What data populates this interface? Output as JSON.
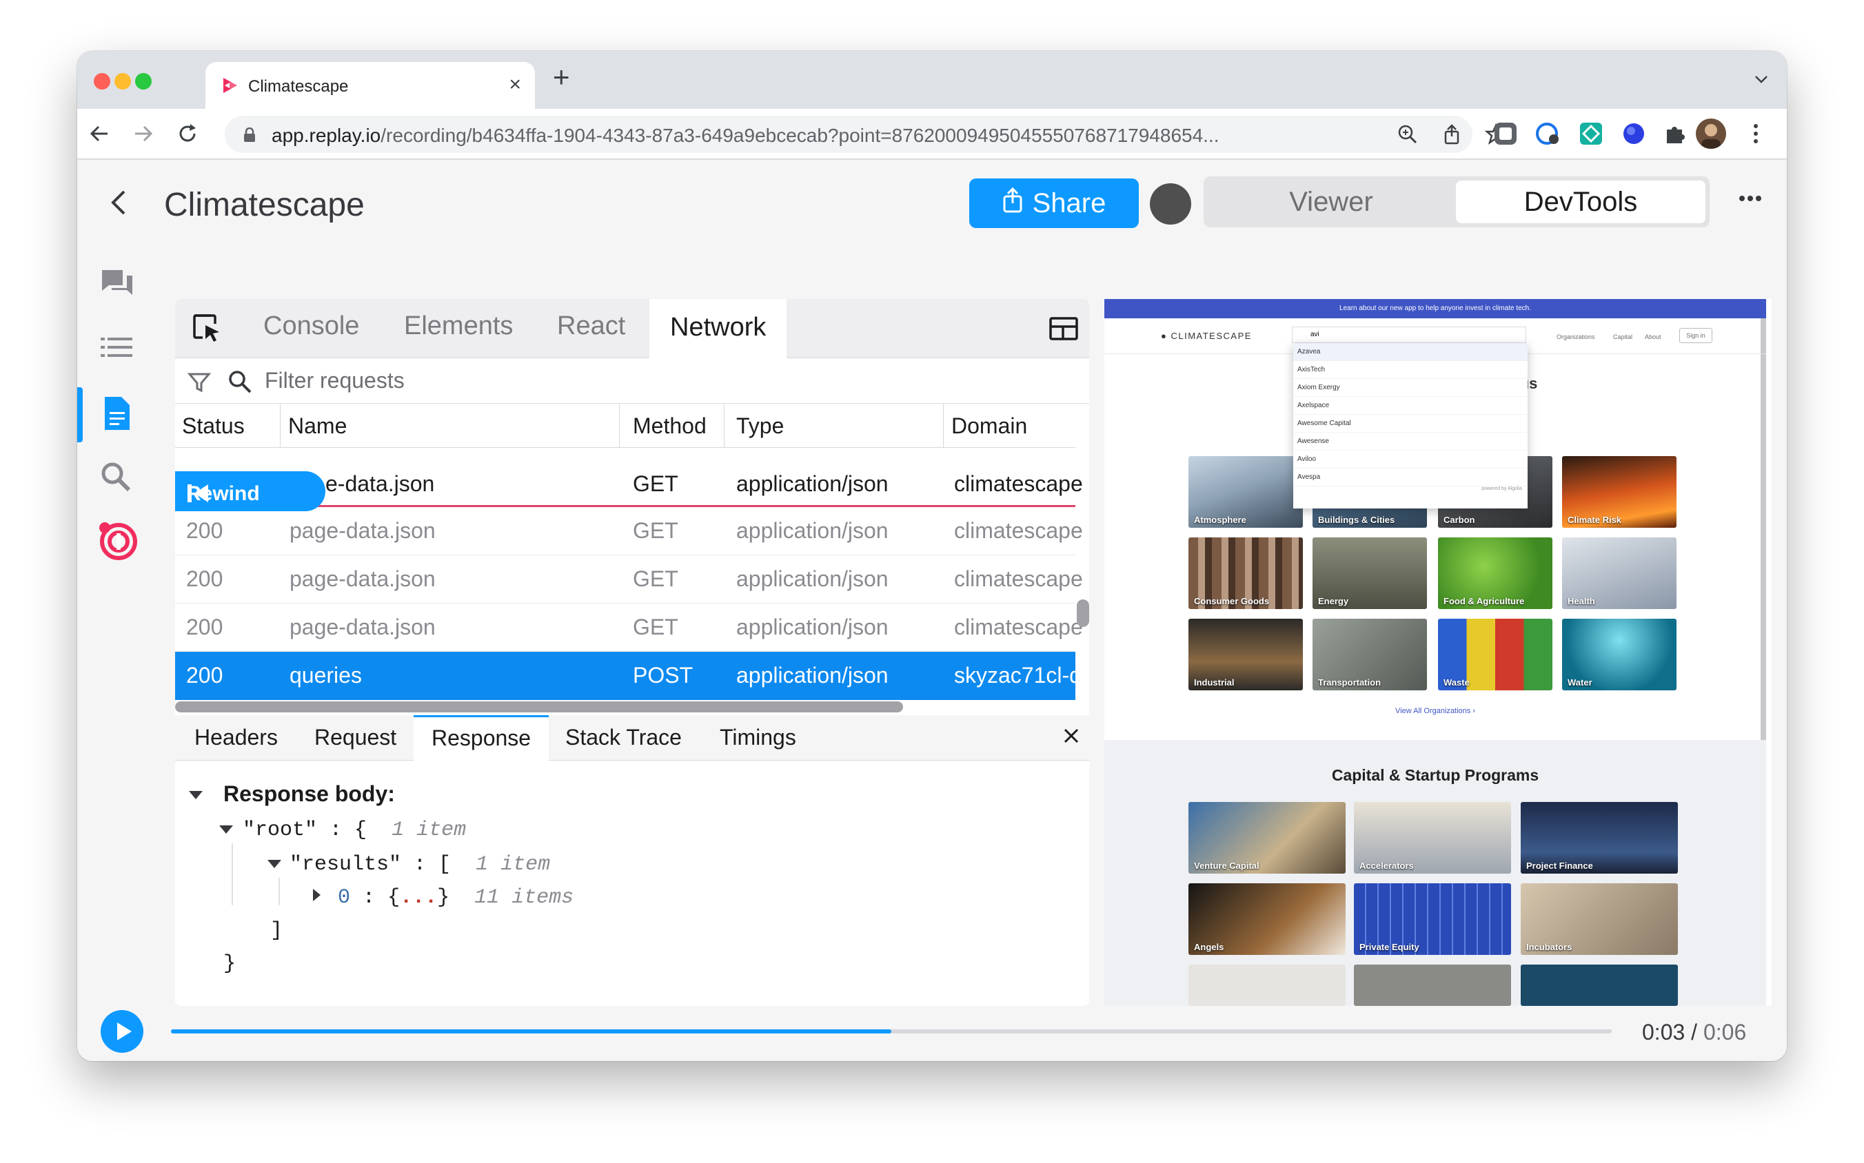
{
  "browser": {
    "tab_title": "Climatescape",
    "url_host": "app.replay.io",
    "url_path": "/recording/b4634ffa-1904-4343-87a3-649a9ebcecab?point=87620009495045550768717948654..."
  },
  "header": {
    "title": "Climatescape",
    "share_label": "Share",
    "modes": [
      "Viewer",
      "DevTools"
    ],
    "active_mode": "DevTools"
  },
  "devtools": {
    "tabs": [
      "Console",
      "Elements",
      "React",
      "Network"
    ],
    "active_tab": "Network",
    "filter_placeholder": "Filter requests",
    "columns": [
      "Status",
      "Name",
      "Method",
      "Type",
      "Domain"
    ],
    "rewind_label": "Rewind",
    "rows": [
      {
        "status": "200",
        "name": "page-data.json",
        "method": "GET",
        "type": "application/json",
        "domain": "climatescape",
        "state": "current"
      },
      {
        "status": "200",
        "name": "page-data.json",
        "method": "GET",
        "type": "application/json",
        "domain": "climatescape",
        "state": "future"
      },
      {
        "status": "200",
        "name": "page-data.json",
        "method": "GET",
        "type": "application/json",
        "domain": "climatescape",
        "state": "future"
      },
      {
        "status": "200",
        "name": "page-data.json",
        "method": "GET",
        "type": "application/json",
        "domain": "climatescape",
        "state": "future"
      },
      {
        "status": "200",
        "name": "queries",
        "method": "POST",
        "type": "application/json",
        "domain": "skyzac71cl-d",
        "state": "selected"
      }
    ],
    "current_row_visible_name": "e-data.json",
    "detail_tabs": [
      "Headers",
      "Request",
      "Response",
      "Stack Trace",
      "Timings"
    ],
    "active_detail_tab": "Response",
    "response": {
      "heading": "Response body:",
      "root_key": "\"root\"",
      "root_brace": ": {",
      "root_count": "1 item",
      "results_key": "\"results\"",
      "results_bracket": ": [",
      "results_count": "1 item",
      "item_key": "0",
      "item_colon": ":",
      "item_open": "{",
      "item_dots": "...",
      "item_close": "}",
      "item_count": "11 items",
      "close_bracket": "]",
      "close_brace": "}"
    }
  },
  "preview": {
    "banner": "Learn about our new app to help anyone invest in climate tech.",
    "logo": "CLIMATESCAPE",
    "search_value": "avi",
    "nav_links": [
      "Organizations",
      "Capital",
      "About"
    ],
    "signin": "Sign in",
    "dropdown_items": [
      "Azavea",
      "AxisTech",
      "Axiom Exergy",
      "Axelspace",
      "Awesome Capital",
      "Awesense",
      "Aviloo",
      "Avespa"
    ],
    "dropdown_footer": "powered by Algolia",
    "section_partial": "ıs",
    "categories": [
      "Atmosphere",
      "Buildings & Cities",
      "Carbon",
      "Climate Risk",
      "Consumer Goods",
      "Energy",
      "Food & Agriculture",
      "Health",
      "Industrial",
      "Transportation",
      "Waste",
      "Water"
    ],
    "view_all": "View All Organizations ›",
    "capital_title": "Capital & Startup Programs",
    "capital_items": [
      "Venture Capital",
      "Accelerators",
      "Project Finance",
      "Angels",
      "Private Equity",
      "Incubators"
    ]
  },
  "timeline": {
    "current": "0:03",
    "separator": "/",
    "total": "0:06",
    "progress": 0.5
  },
  "colors": {
    "accent": "#0d99ff",
    "selected_row": "#0d8af0",
    "rewind_line": "#e0446a"
  }
}
